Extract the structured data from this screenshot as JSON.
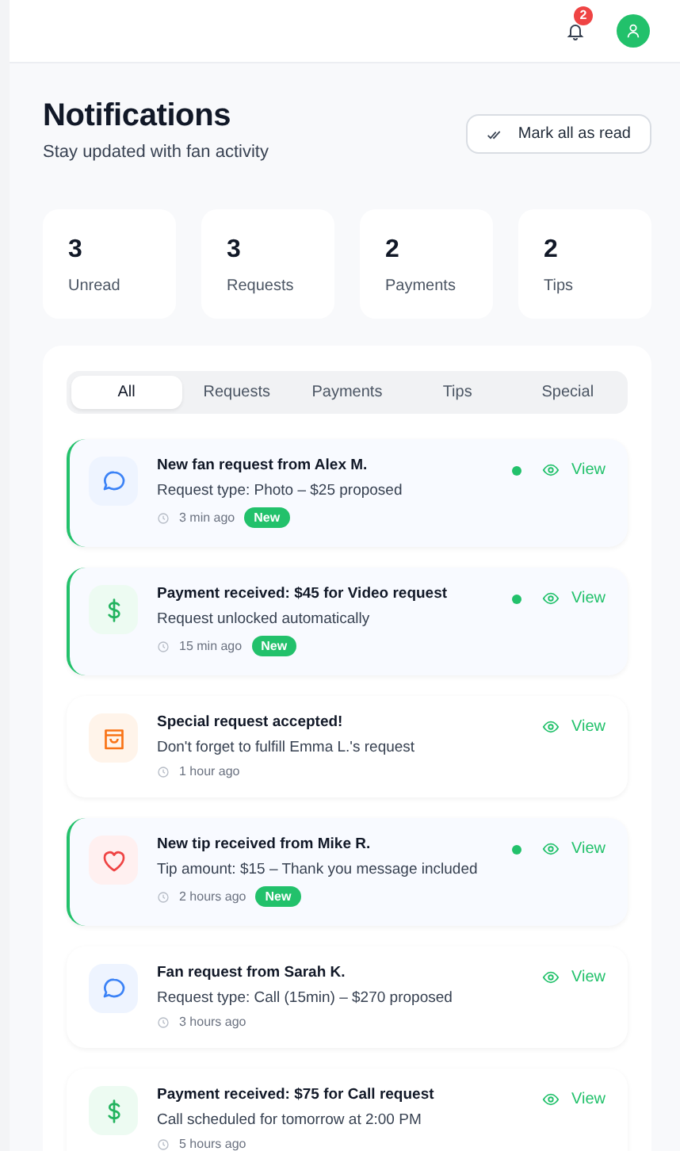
{
  "header": {
    "notification_count": "2"
  },
  "page": {
    "title": "Notifications",
    "subtitle": "Stay updated with fan activity",
    "action": "Mark all as read"
  },
  "stats": [
    {
      "value": "3",
      "label": "Unread"
    },
    {
      "value": "3",
      "label": "Requests"
    },
    {
      "value": "2",
      "label": "Payments"
    },
    {
      "value": "2",
      "label": "Tips"
    }
  ],
  "tabs": [
    {
      "label": "All",
      "selected": true
    },
    {
      "label": "Requests",
      "selected": false
    },
    {
      "label": "Payments",
      "selected": false
    },
    {
      "label": "Tips",
      "selected": false
    },
    {
      "label": "Special",
      "selected": false
    }
  ],
  "notifications": [
    {
      "kind": "request",
      "title": "New fan request from Alex M.",
      "text": "Request type: Photo – $25 proposed",
      "time": "3 min ago",
      "unread": true,
      "badge": "New",
      "action": "View"
    },
    {
      "kind": "payment",
      "title": "Payment received: $45 for Video request",
      "text": "Request unlocked automatically",
      "time": "15 min ago",
      "unread": true,
      "badge": "New",
      "action": "View"
    },
    {
      "kind": "special",
      "title": "Special request accepted!",
      "text": "Don't forget to fulfill Emma L.'s request",
      "time": "1 hour ago",
      "unread": false,
      "action": "View"
    },
    {
      "kind": "tip",
      "title": "New tip received from Mike R.",
      "text": "Tip amount: $15 – Thank you message included",
      "time": "2 hours ago",
      "unread": true,
      "badge": "New",
      "action": "View"
    },
    {
      "kind": "request",
      "title": "Fan request from Sarah K.",
      "text": "Request type: Call (15min) – $270 proposed",
      "time": "3 hours ago",
      "unread": false,
      "action": "View"
    },
    {
      "kind": "payment",
      "title": "Payment received: $75 for Call request",
      "text": "Call scheduled for tomorrow at 2:00 PM",
      "time": "5 hours ago",
      "unread": false,
      "action": "View"
    }
  ]
}
